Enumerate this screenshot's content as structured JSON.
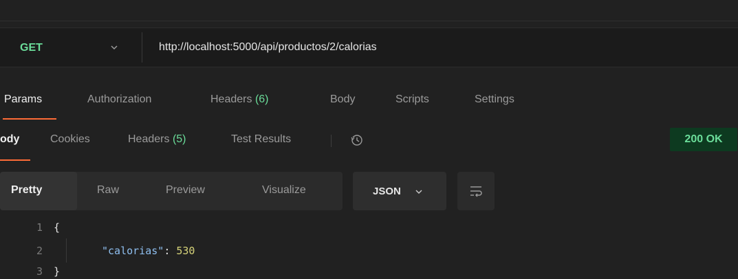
{
  "request": {
    "method": "GET",
    "url": "http://localhost:5000/api/productos/2/calorias"
  },
  "request_tabs": {
    "params": "Params",
    "authorization": "Authorization",
    "headers": "Headers",
    "headers_count": "(6)",
    "body": "Body",
    "scripts": "Scripts",
    "settings": "Settings"
  },
  "response_tabs": {
    "body": "ody",
    "cookies": "Cookies",
    "headers": "Headers",
    "headers_count": "(5)",
    "test_results": "Test Results",
    "status": "200 OK"
  },
  "format": {
    "pretty": "Pretty",
    "raw": "Raw",
    "preview": "Preview",
    "visualize": "Visualize",
    "type": "JSON"
  },
  "code": {
    "line_numbers": [
      "1",
      "2",
      "3"
    ],
    "line1": "{",
    "key": "\"calorias\"",
    "colon": ": ",
    "value": "530",
    "line3": "}"
  },
  "colors": {
    "accent": "#ff6c37",
    "method_green": "#6bdd9a",
    "status_bg": "#0d3a20"
  },
  "icons": [
    "chevron-down-icon",
    "history-icon",
    "wrap-lines-icon"
  ]
}
